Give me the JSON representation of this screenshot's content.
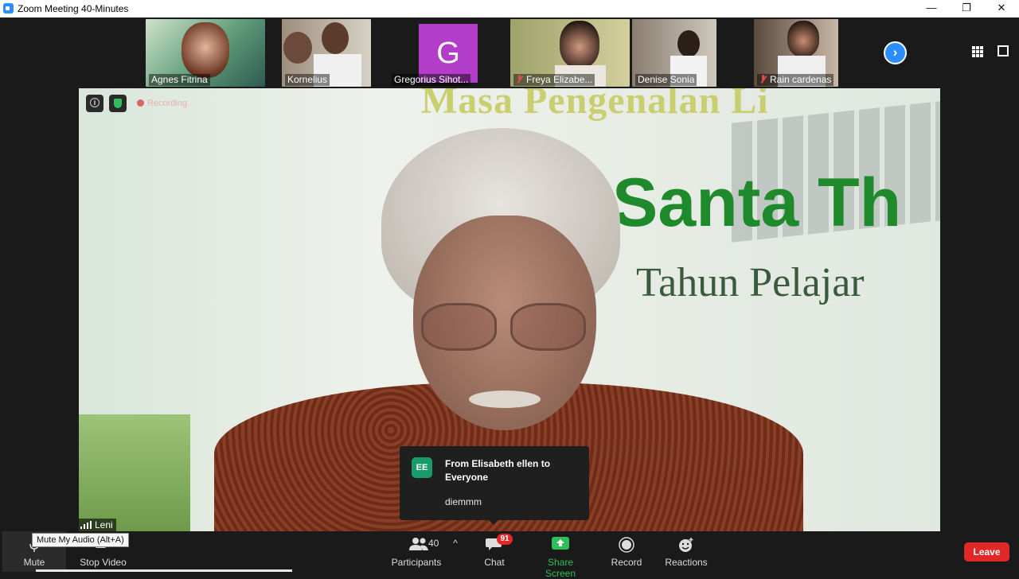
{
  "window": {
    "title": "Zoom Meeting 40-Minutes",
    "minimize": "—",
    "restore": "❐",
    "close": "✕"
  },
  "gallery": {
    "participants": [
      {
        "name": "Agnes Fitrina",
        "muted": false,
        "bg": "#5a8d6e"
      },
      {
        "name": "Kornelius",
        "muted": false,
        "bg": "#8a7b6b"
      },
      {
        "name": "Gregorius Sihot...",
        "muted": false,
        "avatar_letter": "G",
        "avatar_color": "#b13dc8"
      },
      {
        "name": "Freya Elizabe...",
        "muted": true,
        "bg": "#b7b07a"
      },
      {
        "name": "Denise Sonia",
        "muted": false,
        "bg": "#b8b0a4"
      },
      {
        "name": "Rain cardenas",
        "muted": true,
        "bg": "#a0806a"
      }
    ],
    "next_icon": "›"
  },
  "main_video": {
    "banner_line_1": "Masa Pengenalan Li",
    "banner_line_2": "Santa Th",
    "banner_line_3": "Tahun Pelajar",
    "recording_label": "Recording",
    "speaker_name": "Leni"
  },
  "chat_popup": {
    "avatar_initials": "EE",
    "from": "From Elisabeth ellen to Everyone",
    "message": "diemmm"
  },
  "toolbar": {
    "mute_label": "Mute",
    "mute_tooltip": "Mute My Audio (Alt+A)",
    "stop_video_label": "Stop Video",
    "participants_label": "Participants",
    "participants_count": "40",
    "caret": "^",
    "chat_label": "Chat",
    "chat_badge": "91",
    "share_screen_label": "Share Screen",
    "record_label": "Record",
    "reactions_label": "Reactions",
    "leave_label": "Leave"
  },
  "colors": {
    "accent_blue": "#2d8cff",
    "share_green": "#2fbf5a",
    "leave_red": "#e02828"
  }
}
